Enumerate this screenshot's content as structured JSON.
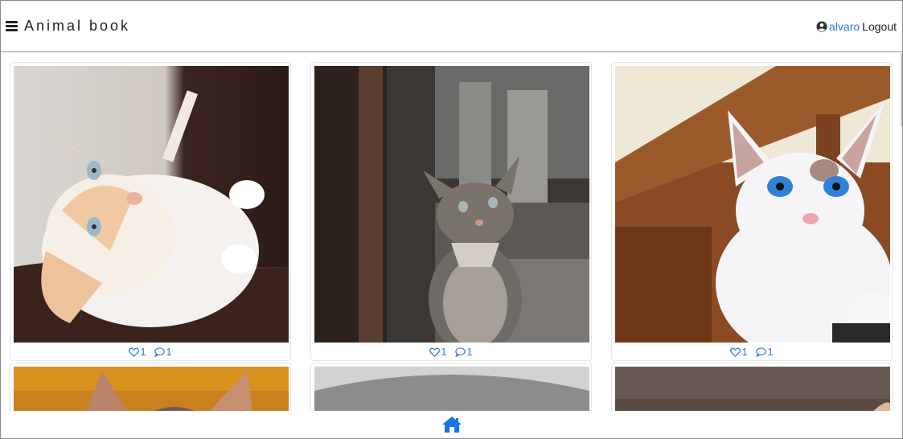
{
  "header": {
    "brand": "Animal book",
    "username": "alvaro",
    "logout_label": "Logout"
  },
  "posts": [
    {
      "likes": "1",
      "comments": "1"
    },
    {
      "likes": "1",
      "comments": "1"
    },
    {
      "likes": "1",
      "comments": "1"
    }
  ],
  "icons": {
    "menu": "bars-icon",
    "user": "user-circle-icon",
    "like": "heart-icon",
    "comment": "comment-icon",
    "home": "home-icon"
  },
  "colors": {
    "accent": "#2a7ae2",
    "home": "#1a73e8"
  }
}
